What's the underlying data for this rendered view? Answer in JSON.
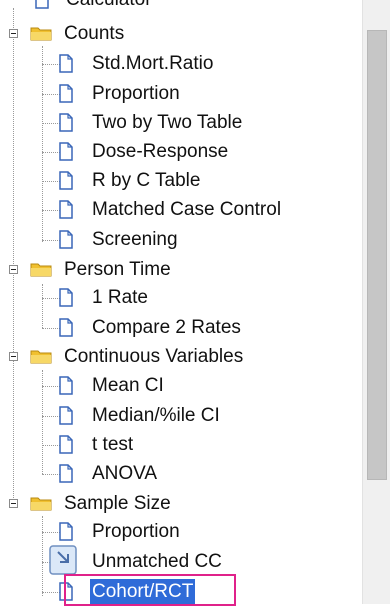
{
  "tree": {
    "top_partial_label": "Calculator",
    "groups": [
      {
        "label": "Counts",
        "items": [
          "Std.Mort.Ratio",
          "Proportion",
          "Two by Two Table",
          "Dose-Response",
          "R by C Table",
          "Matched Case Control",
          "Screening"
        ]
      },
      {
        "label": "Person Time",
        "items": [
          "1 Rate",
          "Compare 2 Rates"
        ]
      },
      {
        "label": "Continuous Variables",
        "items": [
          "Mean CI",
          "Median/%ile CI",
          "t test",
          "ANOVA"
        ]
      },
      {
        "label": "Sample Size",
        "items": [
          "Proportion",
          "Unmatched CC",
          "Cohort/RCT"
        ]
      }
    ],
    "selected_item": "Cohort/RCT"
  },
  "colors": {
    "selection": "#2f6bd8",
    "highlight_box": "#e0218a",
    "folder": "#f0c030",
    "doc_outline": "#3a67b8"
  },
  "icons": {
    "group": "folder-icon",
    "item": "document-icon",
    "expander": "collapse-minus-icon"
  }
}
